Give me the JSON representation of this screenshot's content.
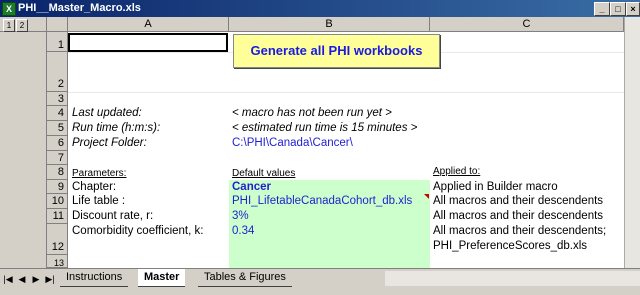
{
  "window": {
    "title": "PHI__Master_Macro.xls",
    "min_label": "_",
    "max_label": "□",
    "close_label": "×"
  },
  "outline": {
    "levels": [
      "1",
      "2"
    ]
  },
  "columns": [
    "A",
    "B",
    "C"
  ],
  "rows": [
    "1",
    "2",
    "3",
    "4",
    "5",
    "6",
    "7",
    "8",
    "9",
    "10",
    "11",
    "",
    "12",
    "13"
  ],
  "button": {
    "label": "Generate all PHI workbooks"
  },
  "info": [
    {
      "label": "Last updated:",
      "value": "< macro has not been run yet >"
    },
    {
      "label": "Run time (h:m:s):",
      "value": "< estimated run time is 15 minutes >"
    },
    {
      "label": "Project Folder:",
      "value": "C:\\PHI\\Canada\\Cancer\\"
    }
  ],
  "params": {
    "header_a": "Parameters:",
    "header_b": "Default values",
    "header_c": "Applied to:",
    "items": [
      {
        "label": "Chapter:",
        "value": "Cancer",
        "applied": "Applied in Builder macro"
      },
      {
        "label": "Life table :",
        "value": "PHI_LifetableCanadaCohort_db.xls",
        "applied": "All macros and their descendents"
      },
      {
        "label": "Discount rate, r:",
        "value": "3%",
        "applied": "All macros and their descendents"
      },
      {
        "label": "Comorbidity coefficient, k:",
        "value": "0.34",
        "applied": "All macros and their descendents;"
      },
      {
        "applied": "PHI_PreferenceScores_db.xls"
      }
    ]
  },
  "tabs": [
    "Instructions",
    "Master",
    "Tables & Figures"
  ],
  "nav": [
    "|◀",
    "◀",
    "▶",
    "▶|"
  ]
}
